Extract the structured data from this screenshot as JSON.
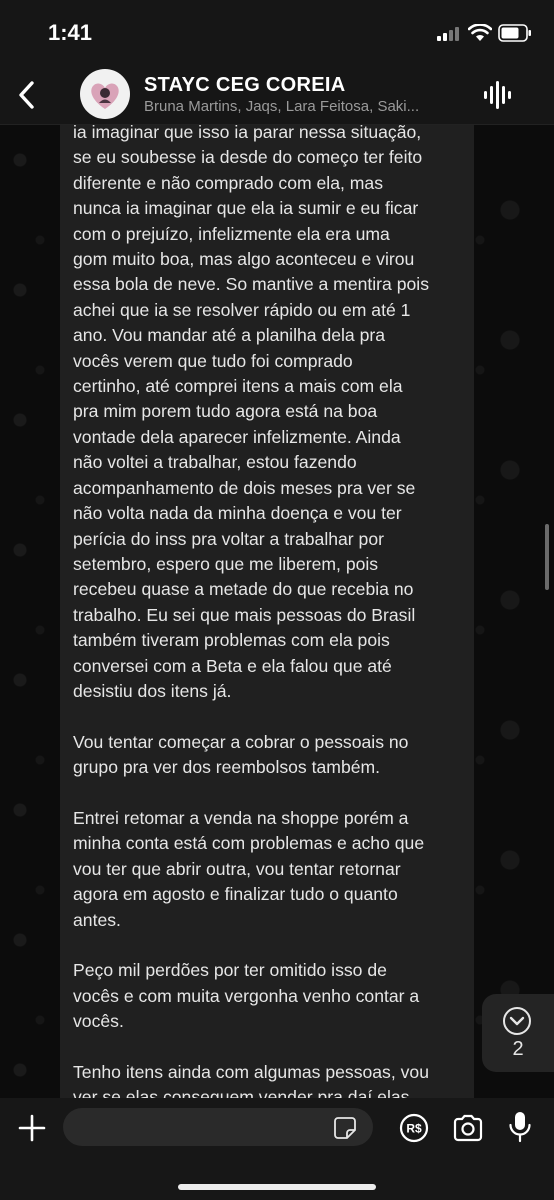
{
  "status_bar": {
    "time": "1:41"
  },
  "header": {
    "group_name": "STAYC CEG COREIA",
    "participants": "Bruna Martins, Jaqs, Lara Feitosa, Saki..."
  },
  "message": {
    "text": "ia imaginar que isso ia parar nessa situação,\nse eu soubesse ia desde do começo ter feito\ndiferente e não comprado com ela, mas\nnunca ia imaginar que ela ia sumir e eu ficar\ncom o prejuízo, infelizmente ela era uma\ngom muito boa, mas algo aconteceu e virou\nessa bola de neve. So mantive a mentira pois\nachei que ia se resolver rápido ou em até 1\nano. Vou mandar até a planilha dela pra\nvocês verem que tudo foi comprado\ncertinho, até comprei itens a mais com ela\npra mim porem tudo agora está na boa\nvontade dela aparecer infelizmente. Ainda\nnão voltei a trabalhar, estou fazendo\nacompanhamento de dois meses pra ver se\nnão volta nada da minha doença e vou ter\nperícia do inss pra voltar a trabalhar por\nsetembro, espero que me liberem, pois\nrecebeu quase a metade do que recebia no\ntrabalho. Eu sei que mais pessoas do Brasil\ntambém tiveram problemas com ela pois\nconversei com a Beta e ela falou que até\ndesistiu dos itens já.\n\nVou tentar começar a cobrar o pessoais no\ngrupo pra ver dos reembolsos também.\n\nEntrei retomar a venda na shoppe porém a\nminha conta está com problemas e acho que\nvou ter que abrir outra, vou tentar retornar\nagora em agosto e finalizar tudo o quanto\nantes.\n\nPeço mil perdões por ter omitido isso de\nvocês e com muita vergonha venho contar a\nvocês.\n\nTenho itens ainda com algumas pessoas, vou\nver se elas conseguem vender pra daí elas"
  },
  "scroll_down": {
    "unread_count": "2"
  },
  "composer": {
    "value": "",
    "placeholder": ""
  },
  "icons": {
    "back": "chevron-left-icon",
    "voice": "audio-waveform-icon",
    "plus": "plus-icon",
    "sticker": "sticker-icon",
    "pix": "pix-payment-icon",
    "camera": "camera-icon",
    "mic": "microphone-icon"
  }
}
